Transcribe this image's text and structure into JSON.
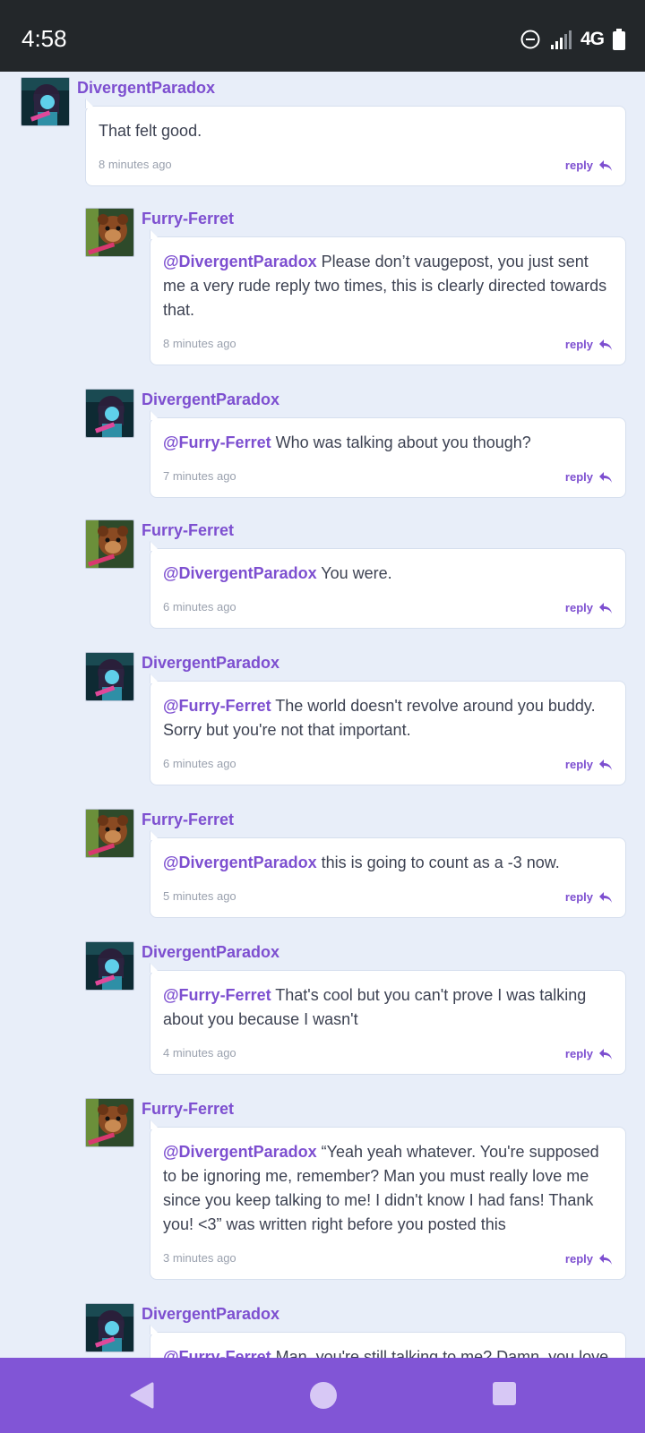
{
  "status_bar": {
    "time": "4:58",
    "network": "4G"
  },
  "colors": {
    "accent": "#7d4fd0",
    "nav_bar": "#8155d6",
    "background": "#e8eef9"
  },
  "comments": [
    {
      "user": "DivergentParadox",
      "avatar": "divergent-avatar",
      "mention": "",
      "text": "That felt good.",
      "time": "8 minutes ago",
      "reply": "reply"
    },
    {
      "user": "Furry-Ferret",
      "avatar": "ferret-avatar",
      "mention": "@DivergentParadox",
      "text": " Please don’t vaugepost, you just sent me a very rude reply two times, this is clearly directed towards that.",
      "time": "8 minutes ago",
      "reply": "reply"
    },
    {
      "user": "DivergentParadox",
      "avatar": "divergent-avatar",
      "mention": "@Furry-Ferret",
      "text": " Who was talking about you though?",
      "time": "7 minutes ago",
      "reply": "reply"
    },
    {
      "user": "Furry-Ferret",
      "avatar": "ferret-avatar",
      "mention": "@DivergentParadox",
      "text": " You were.",
      "time": "6 minutes ago",
      "reply": "reply"
    },
    {
      "user": "DivergentParadox",
      "avatar": "divergent-avatar",
      "mention": "@Furry-Ferret",
      "text": " The world doesn't revolve around you buddy. Sorry but you're not that important.",
      "time": "6 minutes ago",
      "reply": "reply"
    },
    {
      "user": "Furry-Ferret",
      "avatar": "ferret-avatar",
      "mention": "@DivergentParadox",
      "text": " this is going to count as a -3 now.",
      "time": "5 minutes ago",
      "reply": "reply"
    },
    {
      "user": "DivergentParadox",
      "avatar": "divergent-avatar",
      "mention": "@Furry-Ferret",
      "text": " That's cool but you can't prove I was talking about you because I wasn't",
      "time": "4 minutes ago",
      "reply": "reply"
    },
    {
      "user": "Furry-Ferret",
      "avatar": "ferret-avatar",
      "mention": "@DivergentParadox",
      "text": " “Yeah yeah whatever. You're supposed to be ignoring me, remember? Man you must really love me since you keep talking to me! I didn't know I had fans! Thank you! <3” was written right before you posted this",
      "time": "3 minutes ago",
      "reply": "reply"
    },
    {
      "user": "DivergentParadox",
      "avatar": "divergent-avatar",
      "mention": "@Furry-Ferret",
      "text": " Man, you're still talking to me? Damn, you love",
      "time": "",
      "reply": ""
    }
  ],
  "nav": {
    "back": "back-icon",
    "home": "home-icon",
    "recents": "recents-icon"
  }
}
